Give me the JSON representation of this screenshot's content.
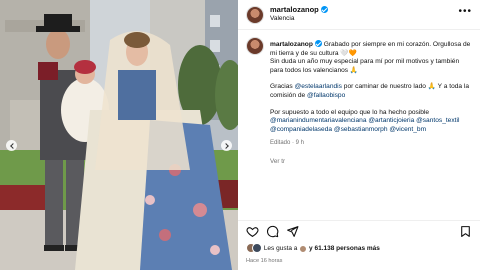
{
  "post": {
    "username": "martalozanop",
    "location": "Valencia",
    "caption_user": "martalozanop",
    "caption_p1": "Grabado por siempre en mi corazón. Orgullosa de mi tierra y de su cultura 🤍🧡",
    "caption_p1b": "Sin duda un año muy especial para mí por mil motivos y también para todos los valencianos 🙏",
    "caption_p2_a": "Gracias",
    "caption_p2_link1": "@estelaarlandis",
    "caption_p2_b": "por caminar de nuestro lado 🙏 Y a toda la comisión de",
    "caption_p2_link2": "@fallaobispo",
    "caption_p3": "Por supuesto a todo el equipo que lo ha hecho posible",
    "caption_p3_links": "@marianindumentariavalenciana @artanticjoieria @santos_textil @companiadelaseda @sebastianmorph @vicent_bm",
    "edited": "Editado · 9 h",
    "translate": "Ver traducción",
    "translate_short": "Ver tr",
    "likes_text_a": "Les gusta a",
    "likes_text_b": "y 61.138 personas más",
    "likes_hidden_user": "",
    "ago": "Hace 16 horas"
  },
  "icons": {
    "more": "more-horizontal-icon",
    "like": "heart-icon",
    "comment": "comment-icon",
    "share": "send-icon",
    "save": "bookmark-icon",
    "verified": "verified-badge-icon",
    "prev": "chevron-left-icon",
    "next": "chevron-right-icon"
  },
  "colors": {
    "link": "#00376b",
    "verified": "#0095f6",
    "muted": "#737373"
  }
}
